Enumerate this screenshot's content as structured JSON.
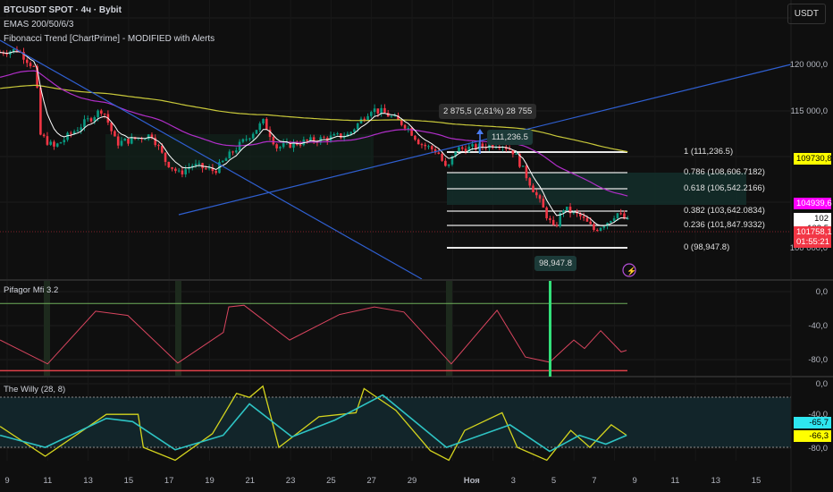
{
  "header": {
    "symbol": "BTCUSDT SPOT · 4ч · Bybit",
    "indicator1": "EMAS 200/50/6/3",
    "indicator2": "Fibonacci Trend [ChartPrime] - MODIFIED with Alerts",
    "currency_button": "USDT"
  },
  "price_axis": {
    "labels": [
      "120 000,0",
      "115 000,0"
    ],
    "ema200": "109730,8",
    "ema50": "104939,6",
    "ema_fast": "102 102,5",
    "last_price": "101758,1",
    "countdown": "01:55:21",
    "hidden": "100 000,0"
  },
  "colors": {
    "up": "#089981",
    "down": "#f23645",
    "ema200": "#c8c83a",
    "ema50": "#b02ec8",
    "ema_fast": "#ffffff",
    "trend": "#2f5fd0",
    "ema200_tag": "#ffff00",
    "ema50_tag": "#ff00ff",
    "last_tag": "#f23645",
    "willy_fast": "#d4d41e",
    "willy_slow": "#2ec4c4"
  },
  "fib": [
    {
      "label": "1 (111,236.5)",
      "price": 111236.5
    },
    {
      "label": "0.786 (108,606.7182)",
      "price": 108606.7182
    },
    {
      "label": "0.618 (106,542.2166)",
      "price": 106542.2166
    },
    {
      "label": "0.382 (103,642.0834)",
      "price": 103642.0834
    },
    {
      "label": "0.236 (101,847.9332)",
      "price": 101847.9332
    },
    {
      "label": "0 (98,947.8)",
      "price": 98947.8
    }
  ],
  "annotations": {
    "measure": "2 875,5 (2,61%) 28 755",
    "high": "111,236.5",
    "low": "98,947.8"
  },
  "mfi": {
    "title": "Pifagor Mfi 3.2",
    "axis": [
      "0,0",
      "-40,0",
      "-80,0"
    ],
    "upper": -14,
    "lower": -93
  },
  "willy": {
    "title": "The Willy (28, 8)",
    "axis": [
      "0,0",
      "-40,0",
      "-80,0"
    ],
    "fast_value": "-66,3",
    "slow_value": "-65,7"
  },
  "time_axis": [
    "9",
    "11",
    "13",
    "15",
    "17",
    "19",
    "21",
    "23",
    "25",
    "27",
    "29",
    "Ноя",
    "3",
    "5",
    "7",
    "9",
    "11",
    "13",
    "15"
  ],
  "chart_data": {
    "type": "candlestick",
    "x_unit": "days since Oct 9",
    "price_keypoints": [
      [
        -0.35,
        121500
      ],
      [
        0.53,
        121800
      ],
      [
        1.41,
        119500
      ],
      [
        1.63,
        112000
      ],
      [
        2.3,
        110500
      ],
      [
        3.62,
        113000
      ],
      [
        4.72,
        115000
      ],
      [
        5.39,
        111000
      ],
      [
        7.15,
        112000
      ],
      [
        7.81,
        109000
      ],
      [
        8.48,
        107500
      ],
      [
        9.14,
        108500
      ],
      [
        10.24,
        107800
      ],
      [
        11.13,
        110000
      ],
      [
        11.79,
        111500
      ],
      [
        12.67,
        113500
      ],
      [
        13.33,
        110500
      ],
      [
        14.22,
        111000
      ],
      [
        15.54,
        111500
      ],
      [
        16.86,
        112000
      ],
      [
        17.97,
        115000
      ],
      [
        18.63,
        114500
      ],
      [
        19.73,
        113000
      ],
      [
        20.4,
        111000
      ],
      [
        21.28,
        110000
      ],
      [
        21.72,
        107800
      ],
      [
        22.16,
        110300
      ],
      [
        23.05,
        110500
      ],
      [
        24.37,
        111000
      ],
      [
        25.03,
        110000
      ],
      [
        25.7,
        107000
      ],
      [
        26.58,
        103000
      ],
      [
        27.02,
        101000
      ],
      [
        27.46,
        103500
      ],
      [
        28.34,
        102500
      ],
      [
        29.0,
        101000
      ],
      [
        29.67,
        102000
      ],
      [
        30.11,
        103000
      ],
      [
        30.77,
        101758
      ]
    ],
    "mfi_points": [
      [
        -0.35,
        -57
      ],
      [
        2.0,
        -85
      ],
      [
        4.37,
        -23
      ],
      [
        5.96,
        -28
      ],
      [
        8.43,
        -84
      ],
      [
        10.68,
        -48
      ],
      [
        10.95,
        -18
      ],
      [
        11.7,
        -16
      ],
      [
        13.95,
        -57
      ],
      [
        16.42,
        -27
      ],
      [
        18.14,
        -18
      ],
      [
        19.6,
        -24
      ],
      [
        21.94,
        -85
      ],
      [
        24.2,
        -22
      ],
      [
        25.6,
        -77
      ],
      [
        26.8,
        -83
      ],
      [
        27.99,
        -57
      ],
      [
        28.52,
        -67
      ],
      [
        29.32,
        -46
      ],
      [
        30.33,
        -71
      ],
      [
        30.6,
        -69
      ]
    ],
    "willy_slow": [
      [
        -0.35,
        -64
      ],
      [
        1.88,
        -79
      ],
      [
        4.9,
        -43
      ],
      [
        6.2,
        -47
      ],
      [
        8.3,
        -82
      ],
      [
        10.67,
        -64
      ],
      [
        11.97,
        -25
      ],
      [
        14.07,
        -66
      ],
      [
        16.2,
        -45
      ],
      [
        18.55,
        -14
      ],
      [
        21.7,
        -79
      ],
      [
        24.84,
        -51
      ],
      [
        26.8,
        -84
      ],
      [
        28.27,
        -64
      ],
      [
        29.57,
        -75
      ],
      [
        30.6,
        -64
      ]
    ],
    "willy_fast": [
      [
        -0.35,
        -53
      ],
      [
        1.88,
        -90
      ],
      [
        4.9,
        -38
      ],
      [
        6.47,
        -38
      ],
      [
        6.73,
        -79
      ],
      [
        8.3,
        -95
      ],
      [
        10.14,
        -62
      ],
      [
        11.33,
        -12
      ],
      [
        11.97,
        -17
      ],
      [
        12.63,
        -3
      ],
      [
        13.42,
        -79
      ],
      [
        15.4,
        -41
      ],
      [
        17.23,
        -36
      ],
      [
        17.63,
        -6
      ],
      [
        19.2,
        -33
      ],
      [
        20.9,
        -83
      ],
      [
        21.82,
        -95
      ],
      [
        22.6,
        -58
      ],
      [
        24.45,
        -36
      ],
      [
        25.2,
        -79
      ],
      [
        26.66,
        -95
      ],
      [
        27.84,
        -58
      ],
      [
        28.78,
        -79
      ],
      [
        29.84,
        -51
      ],
      [
        30.6,
        -64
      ]
    ]
  }
}
